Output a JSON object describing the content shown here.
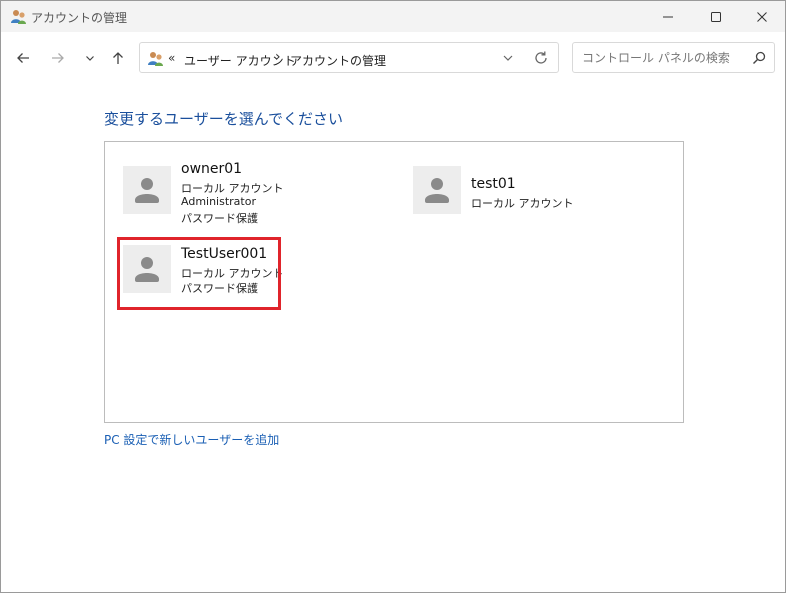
{
  "window": {
    "title": "アカウントの管理"
  },
  "addressbar": {
    "overflow": "«",
    "crumbs": [
      "ユーザー アカウント",
      "アカウントの管理"
    ],
    "separator": "›"
  },
  "search": {
    "placeholder": "コントロール パネルの検索"
  },
  "heading": "変更するユーザーを選んでください",
  "users": [
    {
      "name": "owner01",
      "lines": [
        "ローカル アカウント",
        "Administrator",
        "パスワード保護"
      ]
    },
    {
      "name": "test01",
      "lines": [
        "ローカル アカウント"
      ]
    },
    {
      "name": "TestUser001",
      "lines": [
        "ローカル アカウント",
        "パスワード保護"
      ]
    }
  ],
  "add_user_link": "PC 設定で新しいユーザーを追加",
  "colors": {
    "heading": "#1a4f9c",
    "link": "#1a5fb4",
    "highlight": "#e0242b"
  },
  "icons": [
    "users-app-icon",
    "minimize-icon",
    "maximize-icon",
    "close-icon",
    "back-arrow-icon",
    "forward-arrow-icon",
    "chevron-down-icon",
    "up-arrow-icon",
    "refresh-icon",
    "search-icon",
    "user-avatar-icon"
  ]
}
